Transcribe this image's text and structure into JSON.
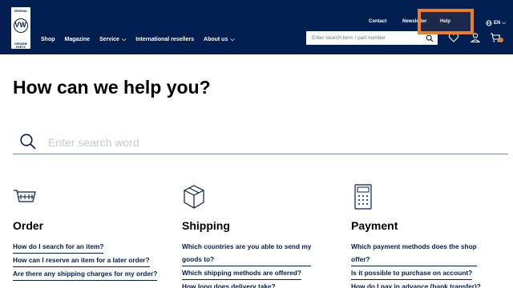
{
  "header": {
    "logo_text_top": "ORIGINAL",
    "logo_text_bottom": "GENUINE PARTS",
    "logo_mark": "VW",
    "nav": [
      {
        "label": "Shop"
      },
      {
        "label": "Magazine"
      },
      {
        "label": "Service",
        "chevron": "⌵"
      },
      {
        "label": "International resellers"
      },
      {
        "label": "About us",
        "chevron": "⌵"
      }
    ],
    "util": {
      "contact": "Contact",
      "newsletter": "Newsletter",
      "help": "Help",
      "language": "EN"
    },
    "search_placeholder": "Enter search term / part number",
    "icons": [
      "search-icon",
      "heart-icon",
      "user-icon",
      "cart-icon",
      "globe-icon"
    ],
    "accent_color": "#001e50",
    "highlight_color": "#f07d22"
  },
  "main": {
    "title": "How can we help you?",
    "search_placeholder": "Enter search word"
  },
  "columns": [
    {
      "title": "Order",
      "icon": "cart-icon",
      "links": [
        [
          "How do I search for an item?"
        ],
        [
          "How can I reserve an item for a later order?"
        ],
        [
          "Are there any shipping charges for my order?"
        ]
      ]
    },
    {
      "title": "Shipping",
      "icon": "box-icon",
      "links": [
        [
          "Which countries are you able to send my",
          "goods to?"
        ],
        [
          "Which shipping methods are offered?"
        ],
        [
          "How long does delivery take?"
        ]
      ]
    },
    {
      "title": "Payment",
      "icon": "calculator-icon",
      "links": [
        [
          "Which payment methods does the shop",
          "offer?"
        ],
        [
          "Is it possible to purchase on account?"
        ],
        [
          "How do I pay in advance (bank transfer)?"
        ]
      ]
    }
  ]
}
